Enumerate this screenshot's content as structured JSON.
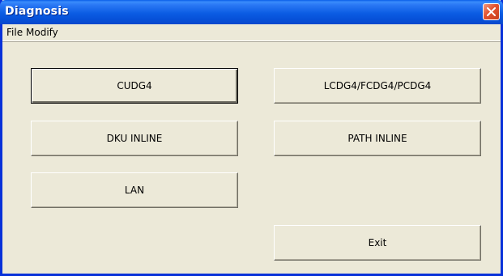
{
  "window": {
    "title": "Diagnosis",
    "close_icon": "close-icon"
  },
  "menu": {
    "file": "File",
    "modify": "Modify"
  },
  "buttons": {
    "cudg4": "CUDG4",
    "lcdg4": "LCDG4/FCDG4/PCDG4",
    "dku_inline": "DKU INLINE",
    "path_inline": "PATH INLINE",
    "lan": "LAN",
    "exit": "Exit"
  },
  "colors": {
    "titlebar": "#0a5fe8",
    "window_bg": "#ece9d8",
    "close_button": "#e2522e"
  }
}
